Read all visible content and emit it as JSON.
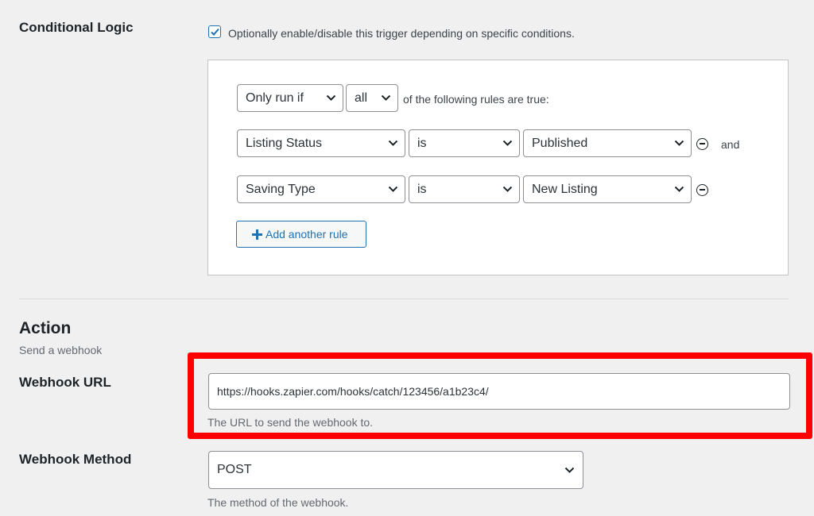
{
  "conditional_logic": {
    "label": "Conditional Logic",
    "enabled": true,
    "checkbox_description": "Optionally enable/disable this trigger depending on specific conditions.",
    "mode_select": "Only run if",
    "match_select": "all",
    "match_suffix": "of the following rules are true:",
    "rules": [
      {
        "field": "Listing Status",
        "operator": "is",
        "value": "Published",
        "joiner": "and"
      },
      {
        "field": "Saving Type",
        "operator": "is",
        "value": "New Listing"
      }
    ],
    "add_rule_label": "Add another rule"
  },
  "action": {
    "title": "Action",
    "subtitle": "Send a webhook"
  },
  "webhook_url": {
    "label": "Webhook URL",
    "value": "https://hooks.zapier.com/hooks/catch/123456/a1b23c4/",
    "description": "The URL to send the webhook to."
  },
  "webhook_method": {
    "label": "Webhook Method",
    "selected": "POST",
    "description": "The method of the webhook."
  },
  "colors": {
    "accent": "#2271b1",
    "highlight": "#ff0000",
    "background": "#f0f0f1"
  },
  "icons": [
    "checkmark-icon",
    "chevron-down-icon",
    "remove-rule-icon",
    "plus-icon"
  ]
}
